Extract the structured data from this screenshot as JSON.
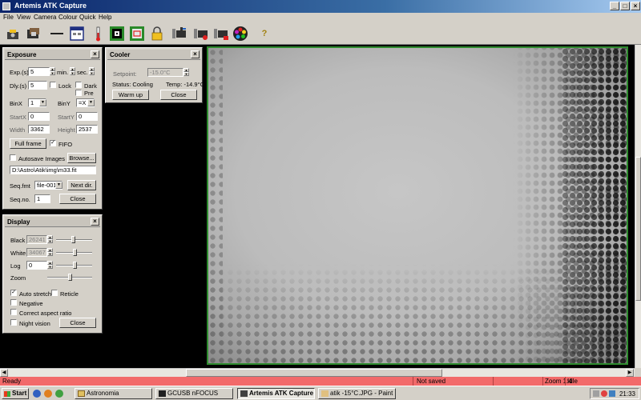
{
  "window": {
    "title": "Artemis ATK Capture"
  },
  "menu": [
    "File",
    "View",
    "Camera",
    "Colour",
    "Quick",
    "Help"
  ],
  "toolbar": {
    "icons": [
      "camera-save-icon",
      "film-icon",
      "line-icon",
      "window-icon",
      "thermometer-icon",
      "target-icon",
      "frame-icon",
      "lock-icon",
      "camera-in-icon",
      "camera-rec-icon",
      "camera-out-icon",
      "color-wheel-icon",
      "help-icon"
    ],
    "help_label": "?"
  },
  "exposure": {
    "title": "Exposure",
    "exp_label": "Exp.(s)",
    "exp_value": "5",
    "min_label": "min.",
    "sec_label": "sec.",
    "dly_label": "Dly.(s)",
    "dly_value": "5",
    "lock_label": "Lock",
    "dark_label": "Dark",
    "pre_label": "Pre",
    "binx_label": "BinX",
    "binx_value": "1",
    "biny_label": "BinY",
    "biny_value": "=X",
    "startx_label": "StartX",
    "startx_value": "0",
    "starty_label": "StartY",
    "starty_value": "0",
    "width_label": "Width",
    "width_value": "3362",
    "height_label": "Height",
    "height_value": "2537",
    "fullframe_label": "Full frame",
    "fifo_label": "FIFO",
    "autosave_label": "Autosave Images",
    "browse_label": "Browse...",
    "path_value": "D:\\Astro\\Atik\\img\\m33.fit",
    "seqfmt_label": "Seq.fmt",
    "seqfmt_value": "file-001",
    "nextdir_label": "Next dir.",
    "seqno_label": "Seq.no.",
    "seqno_value": "1",
    "close_label": "Close"
  },
  "cooler": {
    "title": "Cooler",
    "setpoint_label": "Setpoint:",
    "setpoint_value": "-15.0°C",
    "status_text": "Status: Cooling",
    "temp_text": "Temp: -14.9°C",
    "warmup_label": "Warm up",
    "close_label": "Close"
  },
  "display": {
    "title": "Display",
    "black_label": "Black",
    "black_value": "26241",
    "white_label": "White",
    "white_value": "34067",
    "log_label": "Log",
    "log_value": "0",
    "zoom_label": "Zoom",
    "autostretch_label": "Auto stretch",
    "reticle_label": "Reticle",
    "negative_label": "Negative",
    "aspect_label": "Correct aspect ratio",
    "night_label": "Night vision",
    "close_label": "Close"
  },
  "status": {
    "ready": "Ready",
    "saved": "Not saved",
    "zoom": "Zoom 1:4",
    "state": "Idle"
  },
  "taskbar": {
    "start": "Start",
    "tasks": [
      "Astronomia",
      "GCUSB nFOCUS",
      "Artemis ATK Capture",
      "atik -15°C.JPG - Paint"
    ],
    "clock": "21:33"
  },
  "colors": {
    "status_bar": "#f26a6a",
    "image_border": "#2e8b2e",
    "title_gradient_start": "#0a246a"
  }
}
